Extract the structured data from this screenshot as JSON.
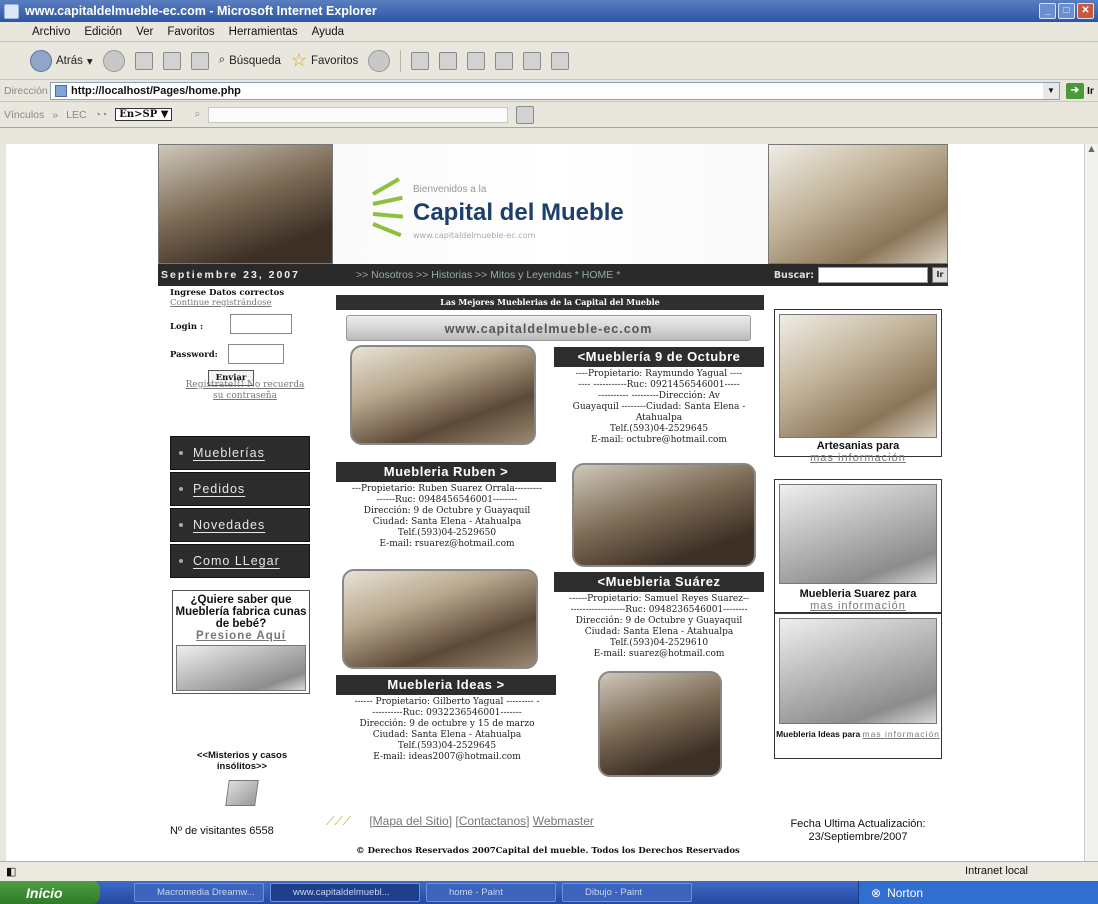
{
  "window": {
    "title": "www.capitaldelmueble-ec.com - Microsoft Internet Explorer"
  },
  "menu": [
    "Archivo",
    "Edición",
    "Ver",
    "Favoritos",
    "Herramientas",
    "Ayuda"
  ],
  "toolbar": {
    "back": "Atrás",
    "search": "Búsqueda",
    "favorites": "Favoritos"
  },
  "address": {
    "label": "Dirección",
    "url": "http://localhost/Pages/home.php",
    "go": "Ir"
  },
  "links": {
    "label": "Vínculos",
    "item": "LEC",
    "translator": "En>SP ▼"
  },
  "site": {
    "welcome": "Bienvenidos a la",
    "name": "Capital del Mueble",
    "url_small": "www.capitaldelmueble-ec.com",
    "date": "Septiembre 23, 2007",
    "nav": ">> Nosotros >> Historias >> Mitos y Leyendas * HOME *",
    "search_label": "Buscar:",
    "search_btn": "Ir"
  },
  "login": {
    "title": "Ingrese Datos correctos",
    "continue": "Continue registrándose",
    "login_label": "Login :",
    "password_label": "Password:",
    "submit": "Enviar",
    "register": "Registrate!!!  No recuerda su contraseña"
  },
  "leftmenu": [
    "Mueblerías",
    "Pedidos",
    "Novedades",
    "Como LLegar"
  ],
  "cunas": {
    "text": "¿Quiere saber que Mueblería fabrica cunas de bebé?",
    "link": "Presione Aquí"
  },
  "misterios": "<<Misterios y casos insólitos>>",
  "visitors": "Nº de visitantes 6558",
  "center": {
    "top_title": "Las Mejores Mueblerias de la Capital del Mueble",
    "banner": "www.capitaldelmueble-ec.com",
    "stores": [
      {
        "title": "<Mueblería 9 de Octubre",
        "lines": [
          "----Propietario: Raymundo Yagual ----",
          "---- -----------Ruc: 0921456546001-----",
          "---------- ---------Dirección: Av",
          "Guayaquil --------Ciudad: Santa Elena -",
          "Atahualpa",
          "Telf.(593)04-2529645",
          "E-mail: octubre@hotmail.com"
        ]
      },
      {
        "title": "Muebleria Ruben >",
        "lines": [
          "---Propietario: Ruben Suarez Orrala---------",
          "------Ruc: 0948456546001--------",
          "Dirección: 9 de Octubre y Guayaquil",
          "Ciudad: Santa Elena - Atahualpa",
          "Telf.(593)04-2529650",
          "E-mail: rsuarez@hotmail.com"
        ]
      },
      {
        "title": "<Muebleria Suárez",
        "lines": [
          "------Propietario: Samuel Reyes Suarez--",
          "------------------Ruc: 0948236546001--------",
          "Dirección: 9 de Octubre y Guayaquil",
          "Ciudad: Santa Elena - Atahualpa",
          "Telf.(593)04-2529610",
          "E-mail: suarez@hotmail.com"
        ]
      },
      {
        "title": "Muebleria Ideas >",
        "lines": [
          "------ Propietario: Gilberto Yagual --------- -",
          "----------Ruc: 0932236546001-------",
          "Dirección: 9 de octubre y 15 de marzo",
          "Ciudad: Santa Elena - Atahualpa",
          "Telf.(593)04-2529645",
          "E-mail: ideas2007@hotmail.com"
        ]
      }
    ]
  },
  "right": [
    {
      "title": "Artesanias para",
      "link": "mas información"
    },
    {
      "title": "Muebleria Suarez para",
      "link": "mas información"
    },
    {
      "title": "Muebleria Ideas para",
      "link": "mas información"
    }
  ],
  "footer": {
    "links": [
      "Mapa del Sitio",
      "Contactanos",
      "Webmaster"
    ],
    "updated_label": "Fecha Ultima Actualización:",
    "updated_date": "23/Septiembre/2007",
    "copyright": "© Derechos Reservados 2007Capital del mueble. Todos los Derechos Reservados"
  },
  "status": {
    "zone": "Intranet local"
  },
  "taskbar": {
    "start": "Inicio",
    "tasks": [
      "Macromedia Dreamw...",
      "www.capitaldelmuebl...",
      "home - Paint",
      "Dibujo - Paint"
    ],
    "tray": "Norton"
  }
}
